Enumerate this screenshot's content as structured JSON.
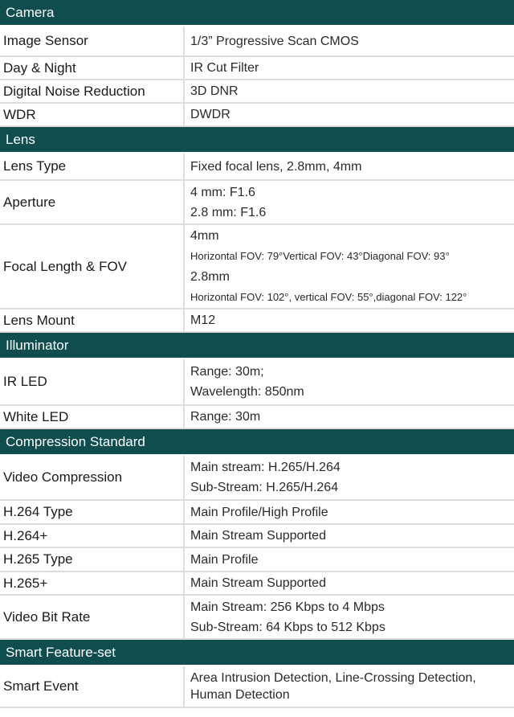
{
  "sections": [
    {
      "title": "Camera",
      "rows": [
        {
          "label": "Image Sensor",
          "lines": [
            "1/3” Progressive Scan CMOS"
          ]
        },
        {
          "label": "Day & Night",
          "lines": [
            "IR Cut Filter"
          ]
        },
        {
          "label": "Digital Noise Reduction",
          "lines": [
            "3D DNR"
          ]
        },
        {
          "label": "WDR",
          "lines": [
            "DWDR"
          ]
        }
      ]
    },
    {
      "title": "Lens",
      "rows": [
        {
          "label": "Lens Type",
          "lines": [
            "Fixed focal lens, 2.8mm, 4mm"
          ]
        },
        {
          "label": "Aperture",
          "lines": [
            "4 mm: F1.6",
            "2.8 mm: F1.6"
          ]
        },
        {
          "label": "Focal Length & FOV",
          "lines": [
            "4mm",
            "Horizontal FOV: 79°Vertical FOV: 43°Diagonal FOV: 93°",
            "2.8mm",
            "Horizontal FOV: 102°, vertical FOV: 55°,diagonal FOV: 122°"
          ]
        },
        {
          "label": "Lens Mount",
          "lines": [
            "M12"
          ]
        }
      ]
    },
    {
      "title": "Illuminator",
      "rows": [
        {
          "label": "IR LED",
          "lines": [
            "Range: 30m;",
            "Wavelength: 850nm"
          ]
        },
        {
          "label": "White LED",
          "lines": [
            "Range: 30m"
          ]
        }
      ]
    },
    {
      "title": "Compression Standard",
      "rows": [
        {
          "label": "Video Compression",
          "lines": [
            "Main stream: H.265/H.264",
            "Sub-Stream: H.265/H.264"
          ]
        },
        {
          "label": "H.264 Type",
          "lines": [
            "Main Profile/High Profile"
          ]
        },
        {
          "label": "H.264+",
          "lines": [
            "Main Stream Supported"
          ]
        },
        {
          "label": "H.265 Type",
          "lines": [
            "Main Profile"
          ]
        },
        {
          "label": "H.265+",
          "lines": [
            "Main Stream Supported"
          ]
        },
        {
          "label": "Video Bit Rate",
          "lines": [
            "Main Stream: 256 Kbps to 4 Mbps",
            "Sub-Stream: 64 Kbps to 512 Kbps"
          ]
        }
      ]
    },
    {
      "title": "Smart Feature-set",
      "rows": [
        {
          "label": "Smart Event",
          "lines": [
            "Area Intrusion Detection, Line-Crossing Detection, Human Detection"
          ]
        }
      ]
    }
  ]
}
